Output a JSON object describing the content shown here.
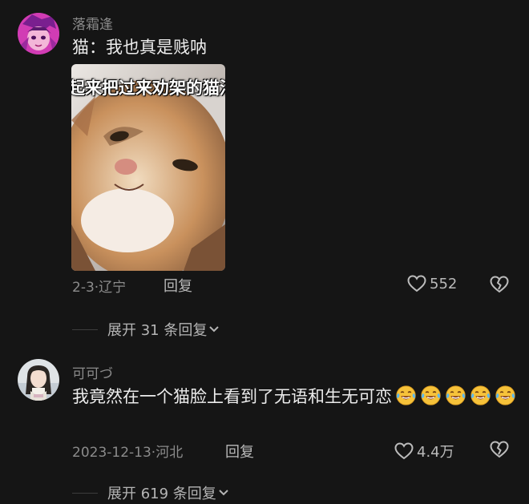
{
  "comments": [
    {
      "username": "落霜逢",
      "text": "猫：我也真是贱呐",
      "image_caption": "起来把过来劝架的猫活",
      "meta": "2-3·辽宁",
      "reply_label": "回复",
      "likes": "552",
      "expand_label": "展开 31 条回复"
    },
    {
      "username": "可可づ",
      "text": "我竟然在一个猫脸上看到了无语和生无可恋",
      "emoji": "laughing-tears-emoji",
      "emoji_count": 5,
      "meta": "2023-12-13·河北",
      "reply_label": "回复",
      "likes": "4.4万",
      "expand_label": "展开 619 条回复"
    }
  ],
  "colors": {
    "background": "#151515",
    "text_primary": "#ececec",
    "text_secondary": "#8b8b8b",
    "emoji_face": "#f6c23a"
  },
  "icons": [
    "heart-outline-icon",
    "broken-heart-icon",
    "chevron-down-icon"
  ]
}
